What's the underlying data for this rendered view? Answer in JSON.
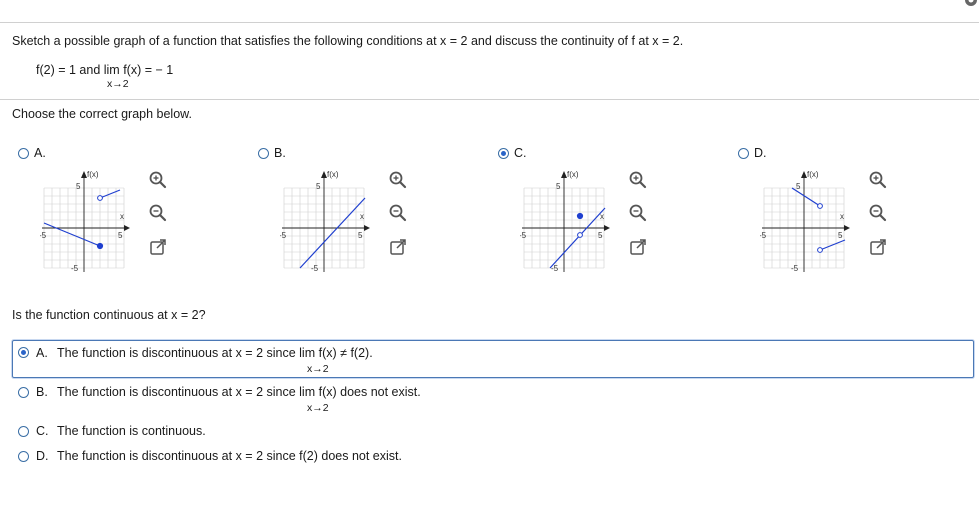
{
  "question": {
    "prompt": "Sketch a possible graph of a function that satisfies the following conditions at x = 2 and discuss the continuity of f at x = 2.",
    "condition_main": "f(2) = 1 and  lim  f(x) = − 1",
    "condition_sub": "x→2",
    "instruction": "Choose the correct graph below."
  },
  "graph_options": [
    {
      "letter": "A.",
      "selected": false,
      "ylabel": "f(x)",
      "xlabel": "x",
      "tick_pos": "5",
      "tick_neg": "-5"
    },
    {
      "letter": "B.",
      "selected": false,
      "ylabel": "f(x)",
      "xlabel": "x",
      "tick_pos": "5",
      "tick_neg": "-5"
    },
    {
      "letter": "C.",
      "selected": true,
      "ylabel": "f(x)",
      "xlabel": "x",
      "tick_pos": "5",
      "tick_neg": "-5"
    },
    {
      "letter": "D.",
      "selected": false,
      "ylabel": "f(x)",
      "xlabel": "x",
      "tick_pos": "5",
      "tick_neg": "-5"
    }
  ],
  "continuity": {
    "question": "Is the function continuous at x = 2?",
    "options": [
      {
        "letter": "A.",
        "text": "The function is discontinuous at x = 2 since  lim  f(x) ≠ f(2).",
        "sub": "x→2",
        "selected": true
      },
      {
        "letter": "B.",
        "text": "The function is discontinuous at x = 2 since  lim  f(x) does not exist.",
        "sub": "x→2",
        "selected": false
      },
      {
        "letter": "C.",
        "text": "The function is continuous.",
        "sub": "",
        "selected": false
      },
      {
        "letter": "D.",
        "text": "The function is discontinuous at x = 2 since f(2) does not exist.",
        "sub": "",
        "selected": false
      }
    ]
  },
  "icons": [
    "zoom-in-icon",
    "zoom-out-icon",
    "popout-icon",
    "gear-icon"
  ],
  "colors": {
    "accent": "#2a64c8",
    "curve": "#1f3fcf",
    "grid": "#cfcfcf"
  }
}
